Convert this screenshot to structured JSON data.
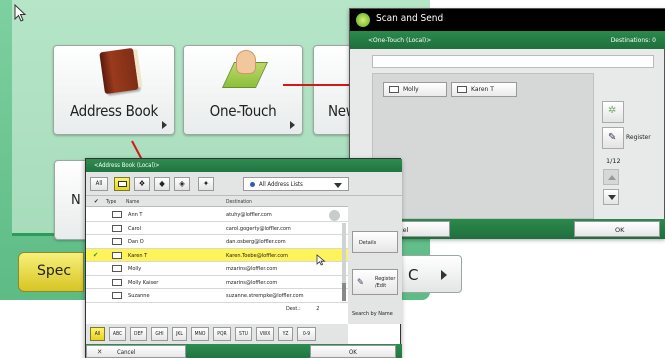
{
  "main_menu": {
    "tiles": {
      "address_book": "Address Book",
      "one_touch": "One-Touch",
      "new_dest": "New D",
      "hidden_tile": "N"
    },
    "special_button": "Spec",
    "bottom_right_letter": "C"
  },
  "scan_window": {
    "title": "Scan and Send",
    "subtitle": "<One-Touch (Local)>",
    "destinations": "Destinations: 0",
    "entries": [
      "Molly",
      "Karen T"
    ],
    "register_label": "Register",
    "page_indicator": "1/12",
    "cancel_label": "ancel",
    "ok_label": "OK"
  },
  "address_book": {
    "title": "<Address Book (Local)>",
    "toolbar": {
      "all_label": "All"
    },
    "list_select": "All Address Lists",
    "columns": {
      "type": "Type",
      "name": "Name",
      "destination": "Destination"
    },
    "rows": [
      {
        "name": "Ann T",
        "dest": "atuhy@loffler.com",
        "selected": false
      },
      {
        "name": "Carol",
        "dest": "carol.gogerty@loffler.com",
        "selected": false
      },
      {
        "name": "Dan O",
        "dest": "dan.osberg@loffler.com",
        "selected": false
      },
      {
        "name": "Karen T",
        "dest": "Karen.Toebe@loffler.com",
        "selected": true
      },
      {
        "name": "Molly",
        "dest": "mzarins@loffler.com",
        "selected": false
      },
      {
        "name": "Molly Kaiser",
        "dest": "mzarins@loffler.com",
        "selected": false
      },
      {
        "name": "Suzanne",
        "dest": "suzanne.strempke@loffler.com",
        "selected": false
      }
    ],
    "dest_count": "Dest.:",
    "dest_count_value": "2",
    "details_label": "Details",
    "register_label": "Register /Edit",
    "search_by_name": "Search by Name",
    "alpha_tabs": [
      "All",
      "ABC",
      "DEF",
      "GHI",
      "JKL",
      "MNO",
      "PQR",
      "STU",
      "VWX",
      "YZ",
      "0-9"
    ],
    "cancel_label": "Cancel",
    "ok_label": "OK"
  },
  "colors": {
    "accent_green": "#2f8c50",
    "selection_yellow": "#fff35a",
    "connector_red": "#d21818"
  }
}
